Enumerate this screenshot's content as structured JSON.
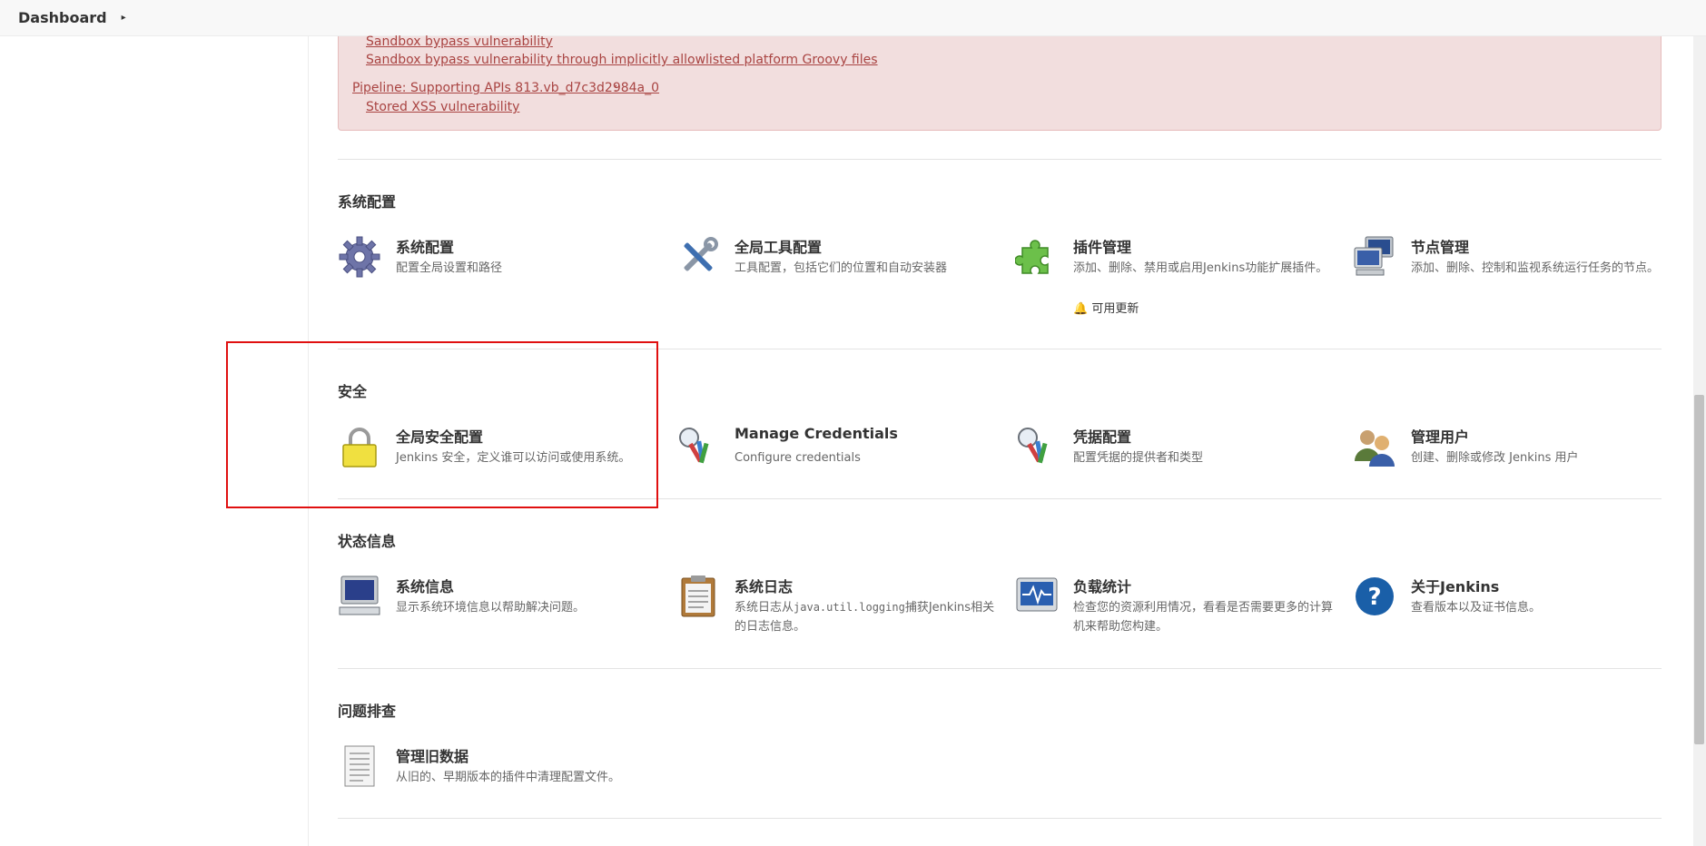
{
  "breadcrumb": {
    "root": "Dashboard"
  },
  "alert": {
    "links": [
      "Sandbox bypass vulnerability",
      "Sandbox bypass vulnerability through implicitly allowlisted platform Groovy files",
      "Pipeline: Supporting APIs 813.vb_d7c3d2984a_0",
      "Stored XSS vulnerability"
    ],
    "colon": ":"
  },
  "sections": {
    "system": {
      "title": "系统配置",
      "items": [
        {
          "name": "系统配置",
          "desc": "配置全局设置和路径"
        },
        {
          "name": "全局工具配置",
          "desc": "工具配置，包括它们的位置和自动安装器"
        },
        {
          "name": "插件管理",
          "desc": "添加、删除、禁用或启用Jenkins功能扩展插件。",
          "badge": "可用更新"
        },
        {
          "name": "节点管理",
          "desc": "添加、删除、控制和监视系统运行任务的节点。"
        }
      ]
    },
    "security": {
      "title": "安全",
      "items": [
        {
          "name": "全局安全配置",
          "desc": "Jenkins 安全，定义谁可以访问或使用系统。"
        },
        {
          "name": "Manage Credentials",
          "desc": "Configure credentials"
        },
        {
          "name": "凭据配置",
          "desc": "配置凭据的提供者和类型"
        },
        {
          "name": "管理用户",
          "desc": "创建、删除或修改 Jenkins 用户"
        }
      ]
    },
    "status": {
      "title": "状态信息",
      "items": [
        {
          "name": "系统信息",
          "desc": "显示系统环境信息以帮助解决问题。"
        },
        {
          "name": "系统日志",
          "desc_pre": "系统日志从",
          "desc_code": "java.util.logging",
          "desc_post": "捕获Jenkins相关的日志信息。"
        },
        {
          "name": "负载统计",
          "desc": "检查您的资源利用情况，看看是否需要更多的计算机来帮助您构建。"
        },
        {
          "name": "关于Jenkins",
          "desc": "查看版本以及证书信息。"
        }
      ]
    },
    "troubleshoot": {
      "title": "问题排查",
      "items": [
        {
          "name": "管理旧数据",
          "desc": "从旧的、早期版本的插件中清理配置文件。"
        }
      ]
    }
  },
  "colors": {
    "alert_bg": "#f2dede",
    "alert_text": "#a94442",
    "highlight": "#e01010"
  }
}
